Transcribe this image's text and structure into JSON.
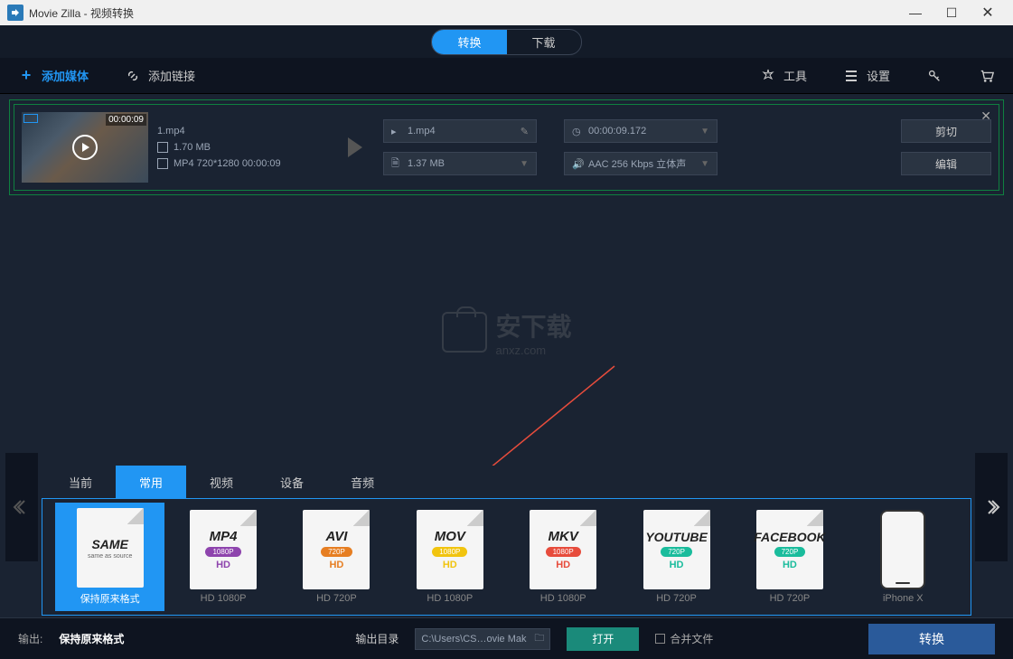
{
  "window": {
    "title": "Movie Zilla - 视频转换"
  },
  "modes": {
    "convert": "转换",
    "download": "下载"
  },
  "toolbar": {
    "add_media": "添加媒体",
    "add_link": "添加链接",
    "tools": "工具",
    "settings": "设置"
  },
  "file": {
    "name": "1.mp4",
    "thumb_time": "00:00:09",
    "size": "1.70 MB",
    "details": "MP4 720*1280 00:00:09",
    "out_name": "1.mp4",
    "out_size": "1.37 MB",
    "duration": "00:00:09.172",
    "audio": "AAC 256 Kbps 立体声",
    "trim_btn": "剪切",
    "edit_btn": "编辑"
  },
  "watermark": {
    "cn": "安下载",
    "en": "anxz.com"
  },
  "format_tabs": {
    "current": "当前",
    "popular": "常用",
    "video": "视频",
    "device": "设备",
    "audio": "音频"
  },
  "formats": [
    {
      "title": "SAME",
      "sub": "same as source",
      "badge": "",
      "badge_color": "#2196f3",
      "hd": "",
      "hd_color": "",
      "label": "保持原来格式",
      "selected": true
    },
    {
      "title": "MP4",
      "sub": "",
      "badge": "1080P",
      "badge_color": "#8e44ad",
      "hd": "HD",
      "hd_color": "#8e44ad",
      "label": "HD 1080P"
    },
    {
      "title": "AVI",
      "sub": "",
      "badge": "720P",
      "badge_color": "#e67e22",
      "hd": "HD",
      "hd_color": "#e67e22",
      "label": "HD 720P"
    },
    {
      "title": "MOV",
      "sub": "",
      "badge": "1080P",
      "badge_color": "#f1c40f",
      "hd": "HD",
      "hd_color": "#f1c40f",
      "label": "HD 1080P"
    },
    {
      "title": "MKV",
      "sub": "",
      "badge": "1080P",
      "badge_color": "#e74c3c",
      "hd": "HD",
      "hd_color": "#e74c3c",
      "label": "HD 1080P"
    },
    {
      "title": "YOUTUBE",
      "sub": "",
      "badge": "720P",
      "badge_color": "#1abc9c",
      "hd": "HD",
      "hd_color": "#1abc9c",
      "label": "HD 720P"
    },
    {
      "title": "FACEBOOK",
      "sub": "",
      "badge": "720P",
      "badge_color": "#1abc9c",
      "hd": "HD",
      "hd_color": "#1abc9c",
      "label": "HD 720P"
    },
    {
      "title": "",
      "sub": "",
      "badge": "",
      "badge_color": "",
      "hd": "",
      "hd_color": "",
      "label": "iPhone X",
      "phone": true
    }
  ],
  "bottom": {
    "output_label": "输出:",
    "output_value": "保持原来格式",
    "output_dir_label": "输出目录",
    "output_path": "C:\\Users\\CS…ovie Mak",
    "open_btn": "打开",
    "merge_label": "合并文件",
    "convert_btn": "转换"
  }
}
